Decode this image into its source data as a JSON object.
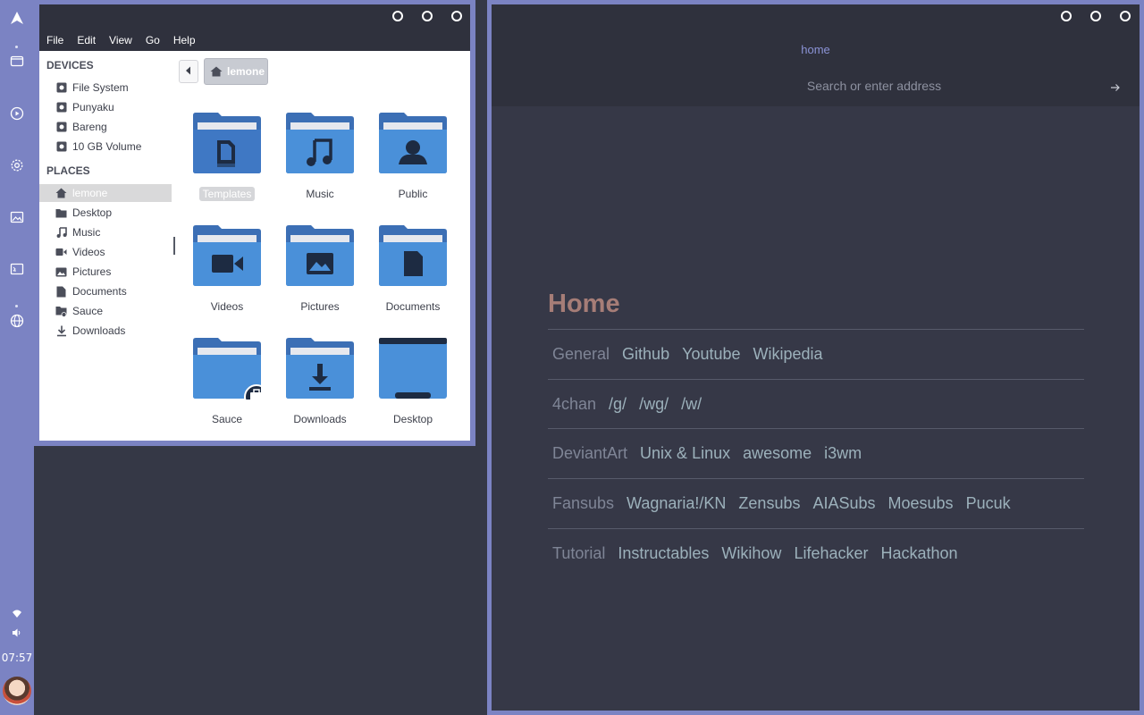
{
  "dock": {
    "icons": [
      "arch-logo-icon",
      "files-icon",
      "media-player-icon",
      "settings-icon",
      "image-viewer-icon",
      "terminal-icon",
      "web-browser-icon"
    ],
    "clock": "07:57",
    "tray": [
      "wifi-icon",
      "volume-icon"
    ]
  },
  "file_manager": {
    "menu": [
      "File",
      "Edit",
      "View",
      "Go",
      "Help"
    ],
    "sidebar": {
      "devices_heading": "DEVICES",
      "devices": [
        "File System",
        "Punyaku",
        "Bareng",
        "10 GB Volume"
      ],
      "places_heading": "PLACES",
      "places": [
        "lemone",
        "Desktop",
        "Music",
        "Videos",
        "Pictures",
        "Documents",
        "Sauce",
        "Downloads"
      ]
    },
    "breadcrumb": "lemone",
    "folders": [
      "Templates",
      "Music",
      "Public",
      "Videos",
      "Pictures",
      "Documents",
      "Sauce",
      "Downloads",
      "Desktop"
    ]
  },
  "browser": {
    "tab_title": "home",
    "address_placeholder": "Search or enter address",
    "page": {
      "title": "Home",
      "rows": [
        {
          "category": "General",
          "links": [
            "Github",
            "Youtube",
            "Wikipedia"
          ]
        },
        {
          "category": "4chan",
          "links": [
            "/g/",
            "/wg/",
            "/w/"
          ]
        },
        {
          "category": "DeviantArt",
          "links": [
            "Unix & Linux",
            "awesome",
            "i3wm"
          ]
        },
        {
          "category": "Fansubs",
          "links": [
            "Wagnaria!/KN",
            "Zensubs",
            "AIASubs",
            "Moesubs",
            "Pucuk"
          ]
        },
        {
          "category": "Tutorial",
          "links": [
            "Instructables",
            "Wikihow",
            "Lifehacker",
            "Hackathon"
          ]
        }
      ]
    }
  },
  "colors": {
    "accent": "#7b83c3",
    "titlebar": "#2f313d",
    "desktop": "#353846",
    "folder_blue": "#4a90d9",
    "home_title": "#a67d77",
    "link": "#9cb1bb"
  }
}
